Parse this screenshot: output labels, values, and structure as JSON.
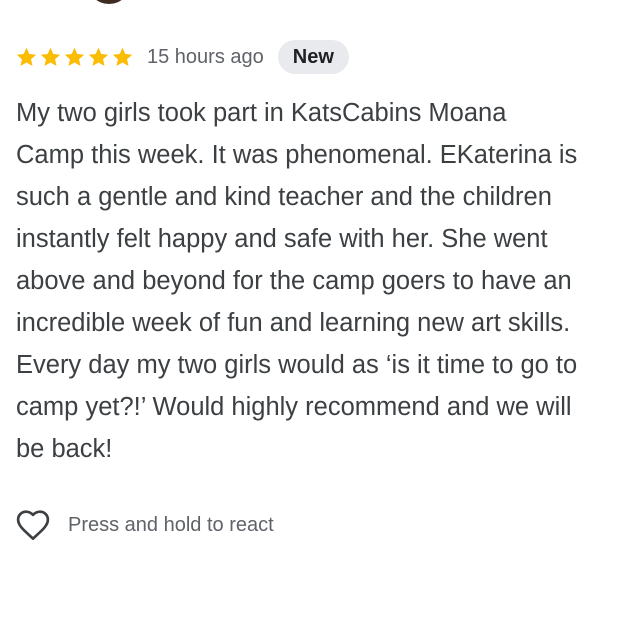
{
  "review": {
    "rating": 5,
    "rating_max": 5,
    "time_ago": "15 hours ago",
    "badge": "New",
    "text": "My two girls took part in KatsCabins Moana\nCamp this week. It was phenomenal. EKaterina is\nsuch a gentle and kind teacher and the children\ninstantly felt happy and safe with her. She went\nabove and beyond for the camp goers to have an\nincredible week of fun and learning new art skills.\nEvery day my two girls would as ‘is it time to go to\ncamp yet?!’ Would highly recommend and we will\nbe back!"
  },
  "react": {
    "label": "Press and hold to react",
    "icon": "heart-outline-icon"
  },
  "colors": {
    "star": "#fbbc04",
    "badge_bg": "#e8eaed",
    "text": "#3c4043",
    "secondary_text": "#5f6368"
  }
}
